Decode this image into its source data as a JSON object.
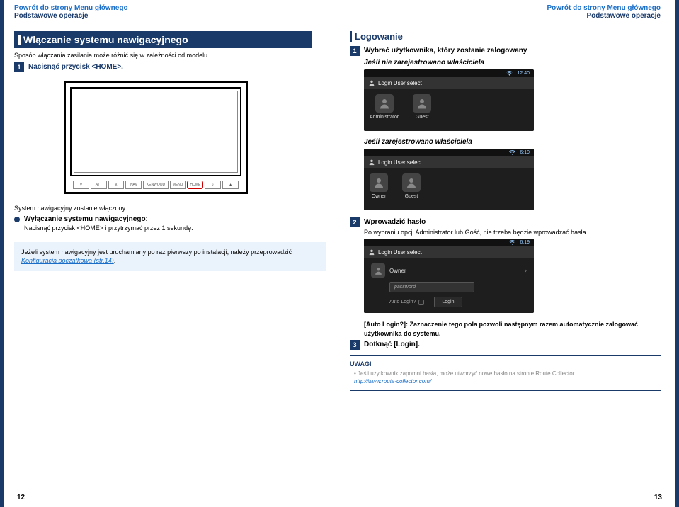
{
  "left": {
    "header_link": "Powrót do strony Menu głównego",
    "breadcrumb": "Podstawowe operacje",
    "section_title": "Włączanie systemu nawigacyjnego",
    "intro": "Sposób włączania zasilania może różnić się w zależności od modelu.",
    "step1": "Nacisnąć przycisk <HOME>.",
    "buttons": {
      "b1": "∇",
      "b2": "ATT",
      "b3": "∧",
      "b4": "NAV",
      "b5": "KENWOOD",
      "b6": "MENU",
      "b7": "HOME",
      "b8": "♪",
      "b9": "▲"
    },
    "followup": "System nawigacyjny zostanie włączony.",
    "bullet_title": "Wyłączanie systemu nawigacyjnego:",
    "bullet_text": "Nacisnąć przycisk <HOME> i przytrzymać przez 1 sekundę.",
    "info": {
      "line1": "Jeżeli system nawigacyjny jest uruchamiany po raz pierwszy po instalacji, należy przeprowadzić ",
      "link": "Konfiguracja początkowa (str.14)",
      "tail": "."
    },
    "page_num": "12"
  },
  "right": {
    "header_link": "Powrót do strony Menu głównego",
    "breadcrumb": "Podstawowe operacje",
    "section_title": "Logowanie",
    "step1": "Wybrać użytkownika, który zostanie zalogowany",
    "case_a": "Jeśli nie zarejestrowano właściciela",
    "screen1": {
      "time": "12:40",
      "title": "Login User select",
      "u1": "Administrator",
      "u2": "Guest"
    },
    "case_b": "Jeśli zarejestrowano właściciela",
    "screen2": {
      "time": "6:19",
      "title": "Login User select",
      "u1": "Owner",
      "u2": "Guest"
    },
    "step2": "Wprowadzić hasło",
    "step2_sub": "Po wybraniu opcji Administrator lub Gość, nie trzeba będzie wprowadzać hasła.",
    "screen3": {
      "time": "6:19",
      "title": "Login User select",
      "owner": "Owner",
      "placeholder": "password",
      "auto_login": "Auto Login?",
      "login": "Login"
    },
    "auto_login_note": "[Auto Login?]: Zaznaczenie tego pola pozwoli następnym razem automatycznie zalogować użytkownika do systemu.",
    "step3": "Dotknąć [Login].",
    "notes": {
      "title": "UWAGI",
      "text": "Jeśli użytkownik zapomni hasła, może utworzyć nowe hasło na stronie Route Collector.",
      "link": "http://www.route-collector.com/"
    },
    "page_num": "13"
  }
}
